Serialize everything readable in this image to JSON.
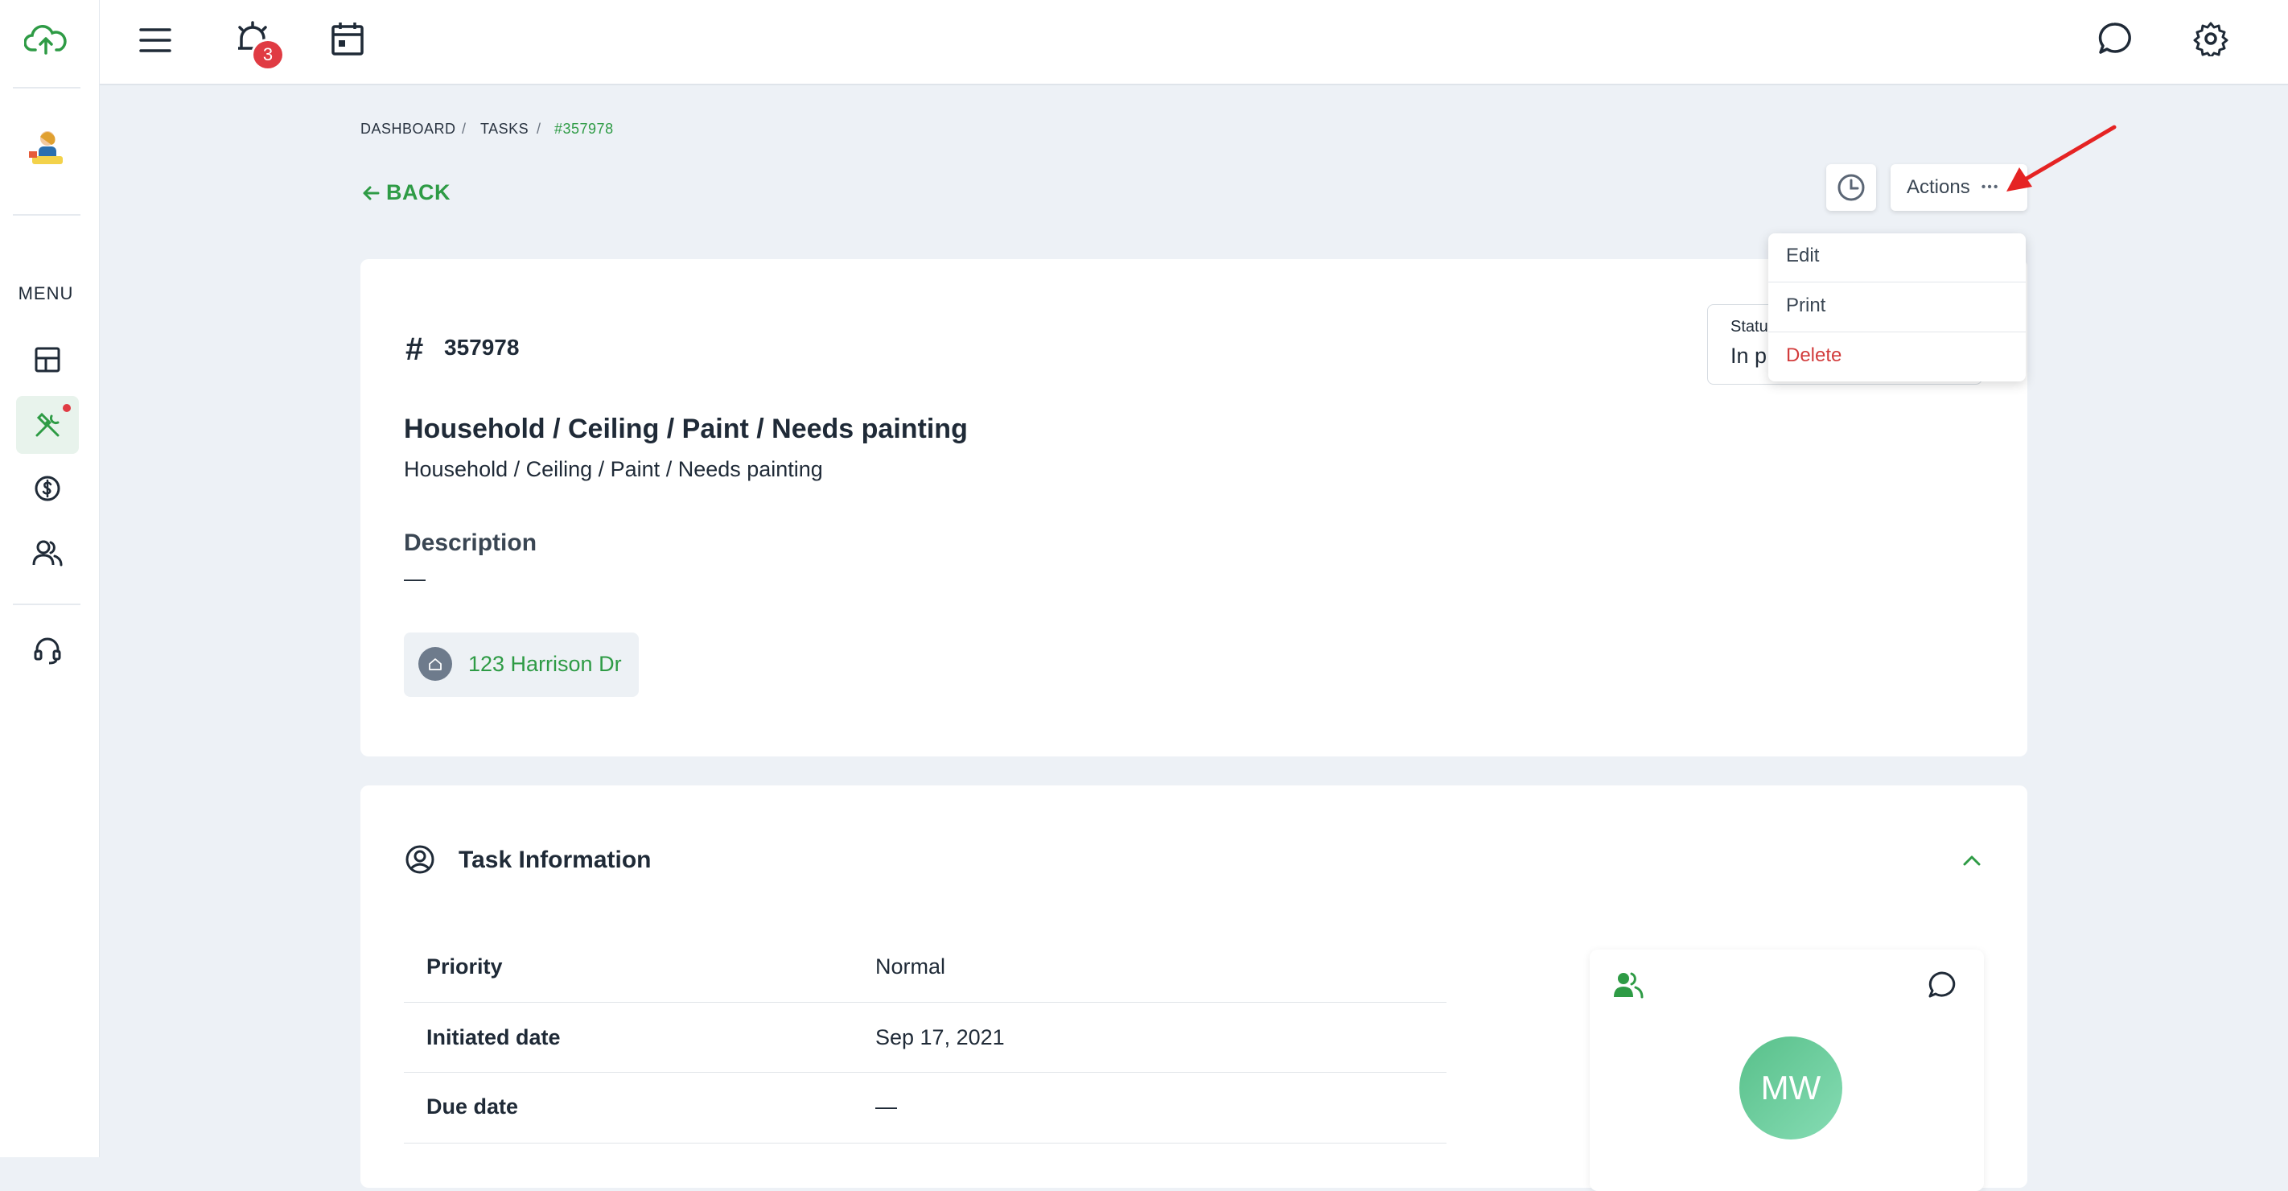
{
  "topbar": {
    "notification_count": "3"
  },
  "sidebar": {
    "menu_label": "MENU"
  },
  "breadcrumb": {
    "items": [
      "DASHBOARD",
      "TASKS",
      "#357978"
    ],
    "separator": "/"
  },
  "back": {
    "label": "BACK"
  },
  "actions": {
    "label": "Actions",
    "dots": "•••",
    "menu": [
      "Edit",
      "Print",
      "Delete"
    ]
  },
  "task": {
    "hash": "#",
    "number": "357978",
    "title": "Household / Ceiling / Paint / Needs painting",
    "subtitle": "Household / Ceiling / Paint / Needs painting",
    "description_label": "Description",
    "description_value": "—",
    "address": "123 Harrison Dr",
    "status_label": "Statu",
    "status_value": "In p"
  },
  "task_info": {
    "title": "Task Information",
    "rows": [
      {
        "label": "Priority",
        "value": "Normal"
      },
      {
        "label": "Initiated date",
        "value": "Sep 17, 2021"
      },
      {
        "label": "Due date",
        "value": "—"
      }
    ],
    "assignee_initials": "MW"
  },
  "colors": {
    "accent": "#2e9b45",
    "danger": "#e03b43",
    "delete": "#d23c3c"
  },
  "icons": [
    "cloud-upload-icon",
    "hamburger-icon",
    "alarm-icon",
    "calendar-icon",
    "chat-icon",
    "gear-icon",
    "dashboard-grid-icon",
    "tools-icon",
    "dollar-icon",
    "users-icon",
    "headset-icon",
    "clock-icon",
    "home-icon",
    "user-circle-icon",
    "chevron-up-icon"
  ]
}
